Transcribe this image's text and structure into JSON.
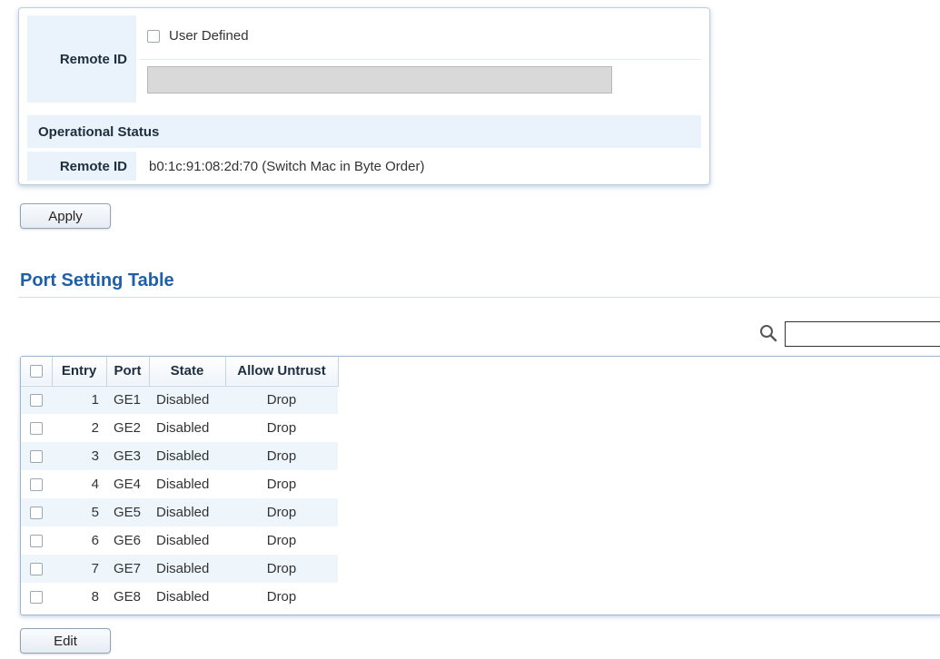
{
  "remote_id_config": {
    "label": "Remote ID",
    "user_defined_label": "User Defined",
    "user_defined_checked": false,
    "value": ""
  },
  "operational_status": {
    "header": "Operational Status",
    "remote_id_label": "Remote ID",
    "remote_id_value": "b0:1c:91:08:2d:70 (Switch Mac in Byte Order)"
  },
  "buttons": {
    "apply": "Apply",
    "edit": "Edit"
  },
  "port_setting_table": {
    "title": "Port Setting Table",
    "search_value": "",
    "columns": [
      "Entry",
      "Port",
      "State",
      "Allow Untrust"
    ],
    "rows": [
      {
        "entry": "1",
        "port": "GE1",
        "state": "Disabled",
        "allow_untrust": "Drop"
      },
      {
        "entry": "2",
        "port": "GE2",
        "state": "Disabled",
        "allow_untrust": "Drop"
      },
      {
        "entry": "3",
        "port": "GE3",
        "state": "Disabled",
        "allow_untrust": "Drop"
      },
      {
        "entry": "4",
        "port": "GE4",
        "state": "Disabled",
        "allow_untrust": "Drop"
      },
      {
        "entry": "5",
        "port": "GE5",
        "state": "Disabled",
        "allow_untrust": "Drop"
      },
      {
        "entry": "6",
        "port": "GE6",
        "state": "Disabled",
        "allow_untrust": "Drop"
      },
      {
        "entry": "7",
        "port": "GE7",
        "state": "Disabled",
        "allow_untrust": "Drop"
      },
      {
        "entry": "8",
        "port": "GE8",
        "state": "Disabled",
        "allow_untrust": "Drop"
      }
    ]
  },
  "colors": {
    "accent_title": "#1f5fa8",
    "label_bg": "#eaf3fb",
    "row_alt_bg": "#eef6fc"
  },
  "icons": {
    "search": "search-icon"
  }
}
